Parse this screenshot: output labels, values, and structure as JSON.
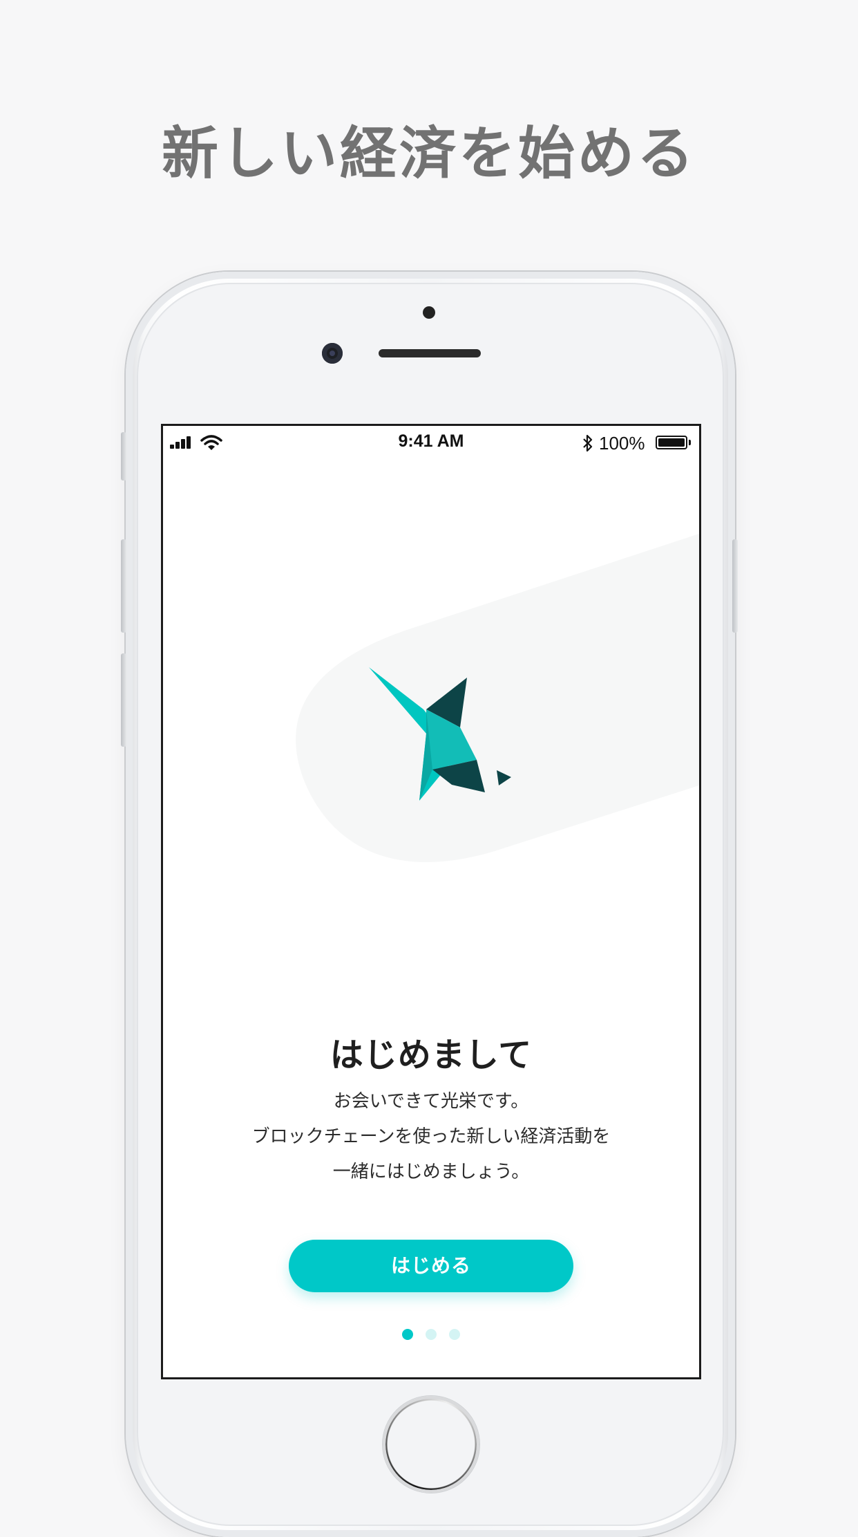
{
  "headline": "新しい経済を始める",
  "status_bar": {
    "time": "9:41 AM",
    "battery_percent": "100%",
    "battery_level": 1.0
  },
  "onboarding": {
    "title": "はじめまして",
    "lines": [
      "お会いできて光栄です。",
      "ブロックチェーンを使った新しい経済活動を",
      "一緒にはじめましょう。"
    ],
    "start_button": "はじめる",
    "page_count": 3,
    "current_page": 1
  },
  "icons": [
    "signal-icon",
    "wifi-icon",
    "bluetooth-icon",
    "battery-icon",
    "origami-logo"
  ],
  "colors": {
    "accent": "#00c8c8",
    "logo_dark": "#0d4447",
    "dot_inactive": "#d4f4f4",
    "headline": "#727272"
  }
}
